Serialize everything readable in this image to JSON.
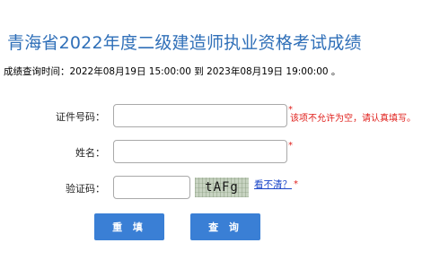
{
  "header": {
    "title": "青海省2022年度二级建造师执业资格考试成绩",
    "query_time": "成绩查询时间：2022年08月19日 15:00:00 到 2023年08月19日 19:00:00 。"
  },
  "form": {
    "id_number": {
      "label": "证件号码：",
      "value": "",
      "error": "该项不允许为空，请认真填写。",
      "required_mark": "*"
    },
    "name": {
      "label": "姓名：",
      "value": "",
      "required_mark": "*"
    },
    "captcha": {
      "label": "验证码：",
      "value": "",
      "image_text": "tAFg",
      "refresh_text": "看不清？",
      "required_mark": "*"
    }
  },
  "buttons": {
    "reset_label": "重 填",
    "query_label": "查 询",
    "color": "#3a7fd5"
  },
  "colors": {
    "title": "#2f6fb8",
    "error": "#e0201c",
    "link": "#1a45c8"
  }
}
